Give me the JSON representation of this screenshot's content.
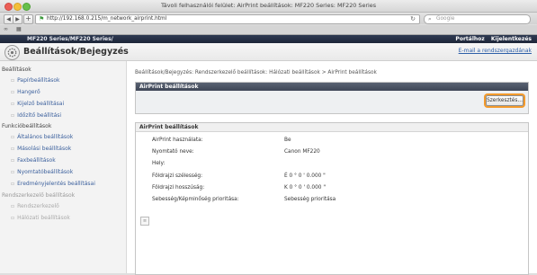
{
  "browser": {
    "window_title": "Távoli felhasználói felület: AirPrint beállítások: MF220 Series: MF220 Series",
    "url": "http://192.168.0.215/m_network_airprint.html",
    "search_placeholder": "Google",
    "nav": {
      "back": "◀",
      "forward": "▶",
      "add": "+"
    }
  },
  "header": {
    "device": "MF220 Series/MF220 Series/",
    "portal": "Portálhoz",
    "logout": "Kijelentkezés"
  },
  "title_bar": {
    "title": "Beállítások/Bejegyzés",
    "email_link": "E-mail a rendszergazdának"
  },
  "sidebar": {
    "groups": [
      {
        "label": "Beállítások",
        "items": [
          "Papírbeállítások",
          "Hangerő",
          "Kijelző beállításai",
          "Időzítő beállítási"
        ]
      },
      {
        "label": "Funkcióbeállítások",
        "items": [
          "Általános beállítások",
          "Másolási beállítások",
          "Faxbeállítások",
          "Nyomtatóbeállítások",
          "Eredményjelentés beállításai"
        ]
      },
      {
        "label": "Rendszerkezelő beállítások",
        "items": [
          "Rendszerkezelő",
          "Hálózati beállítások"
        ]
      }
    ]
  },
  "main": {
    "breadcrumb": "Beállítások/Bejegyzés: Rendszerkezelő beállítások: Hálózati beállítások > AirPrint beállítások",
    "panel1_title": "AirPrint beállítások",
    "edit_button": "Szerkesztés...",
    "panel2_title": "AirPrint beállítások",
    "rows": [
      {
        "label": "AirPrint használata:",
        "value": "Be"
      },
      {
        "label": "Nyomtató neve:",
        "value": "Canon MF220"
      },
      {
        "label": "Hely:",
        "value": ""
      },
      {
        "label": "Földrajzi szélesség:",
        "value": "É 0 ° 0 ' 0.000 \""
      },
      {
        "label": "Földrajzi hosszúság:",
        "value": "K 0 ° 0 ' 0.000 \""
      },
      {
        "label": "Sebesség/Képminőség prioritása:",
        "value": "Sebesség prioritása"
      }
    ]
  }
}
